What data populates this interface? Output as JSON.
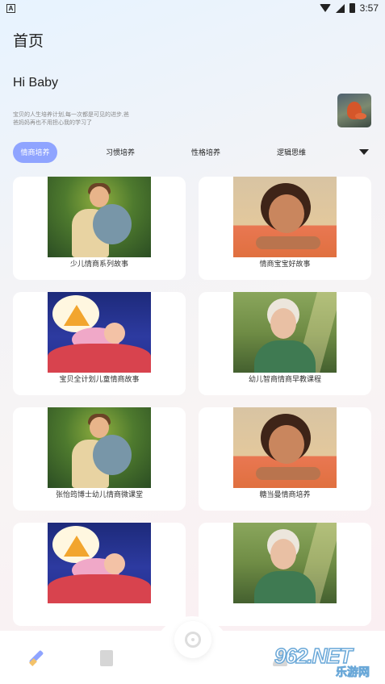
{
  "status_bar": {
    "time": "3:57",
    "left_badge": "A"
  },
  "page_title": "首页",
  "greeting": "Hi Baby",
  "description": "宝贝的人生培养计划,每一次都是可见的进步,爸爸妈妈再也不用担心我的学习了",
  "tabs": [
    {
      "label": "情商培养",
      "active": true
    },
    {
      "label": "习惯培养",
      "active": false
    },
    {
      "label": "性格培养",
      "active": false
    },
    {
      "label": "逻辑思维",
      "active": false
    }
  ],
  "cards": [
    {
      "title": "少儿情商系列故事",
      "image": "boy-koala"
    },
    {
      "title": "情商宝宝好故事",
      "image": "girl-portrait"
    },
    {
      "title": "宝贝全计划儿童情商故事",
      "image": "sleeping-child"
    },
    {
      "title": "幼儿智商情商早教课程",
      "image": "old-woman-forest"
    },
    {
      "title": "张怡筠博士幼儿情商微课堂",
      "image": "boy-koala"
    },
    {
      "title": "糖当曼情商培养",
      "image": "girl-portrait"
    },
    {
      "title": "",
      "image": "sleeping-child"
    },
    {
      "title": "",
      "image": "old-woman-forest"
    }
  ],
  "bottom_nav": {
    "items": [
      {
        "icon": "pencil-icon",
        "active": true
      },
      {
        "icon": "book-icon",
        "active": false
      },
      {
        "icon": "music-disc-icon",
        "active": false
      },
      {
        "icon": "profile-icon",
        "active": false
      }
    ]
  },
  "watermark": {
    "brand": "962.NET",
    "sub": "乐游网"
  },
  "colors": {
    "accent": "#8fa4ff",
    "card_bg": "#ffffff"
  }
}
